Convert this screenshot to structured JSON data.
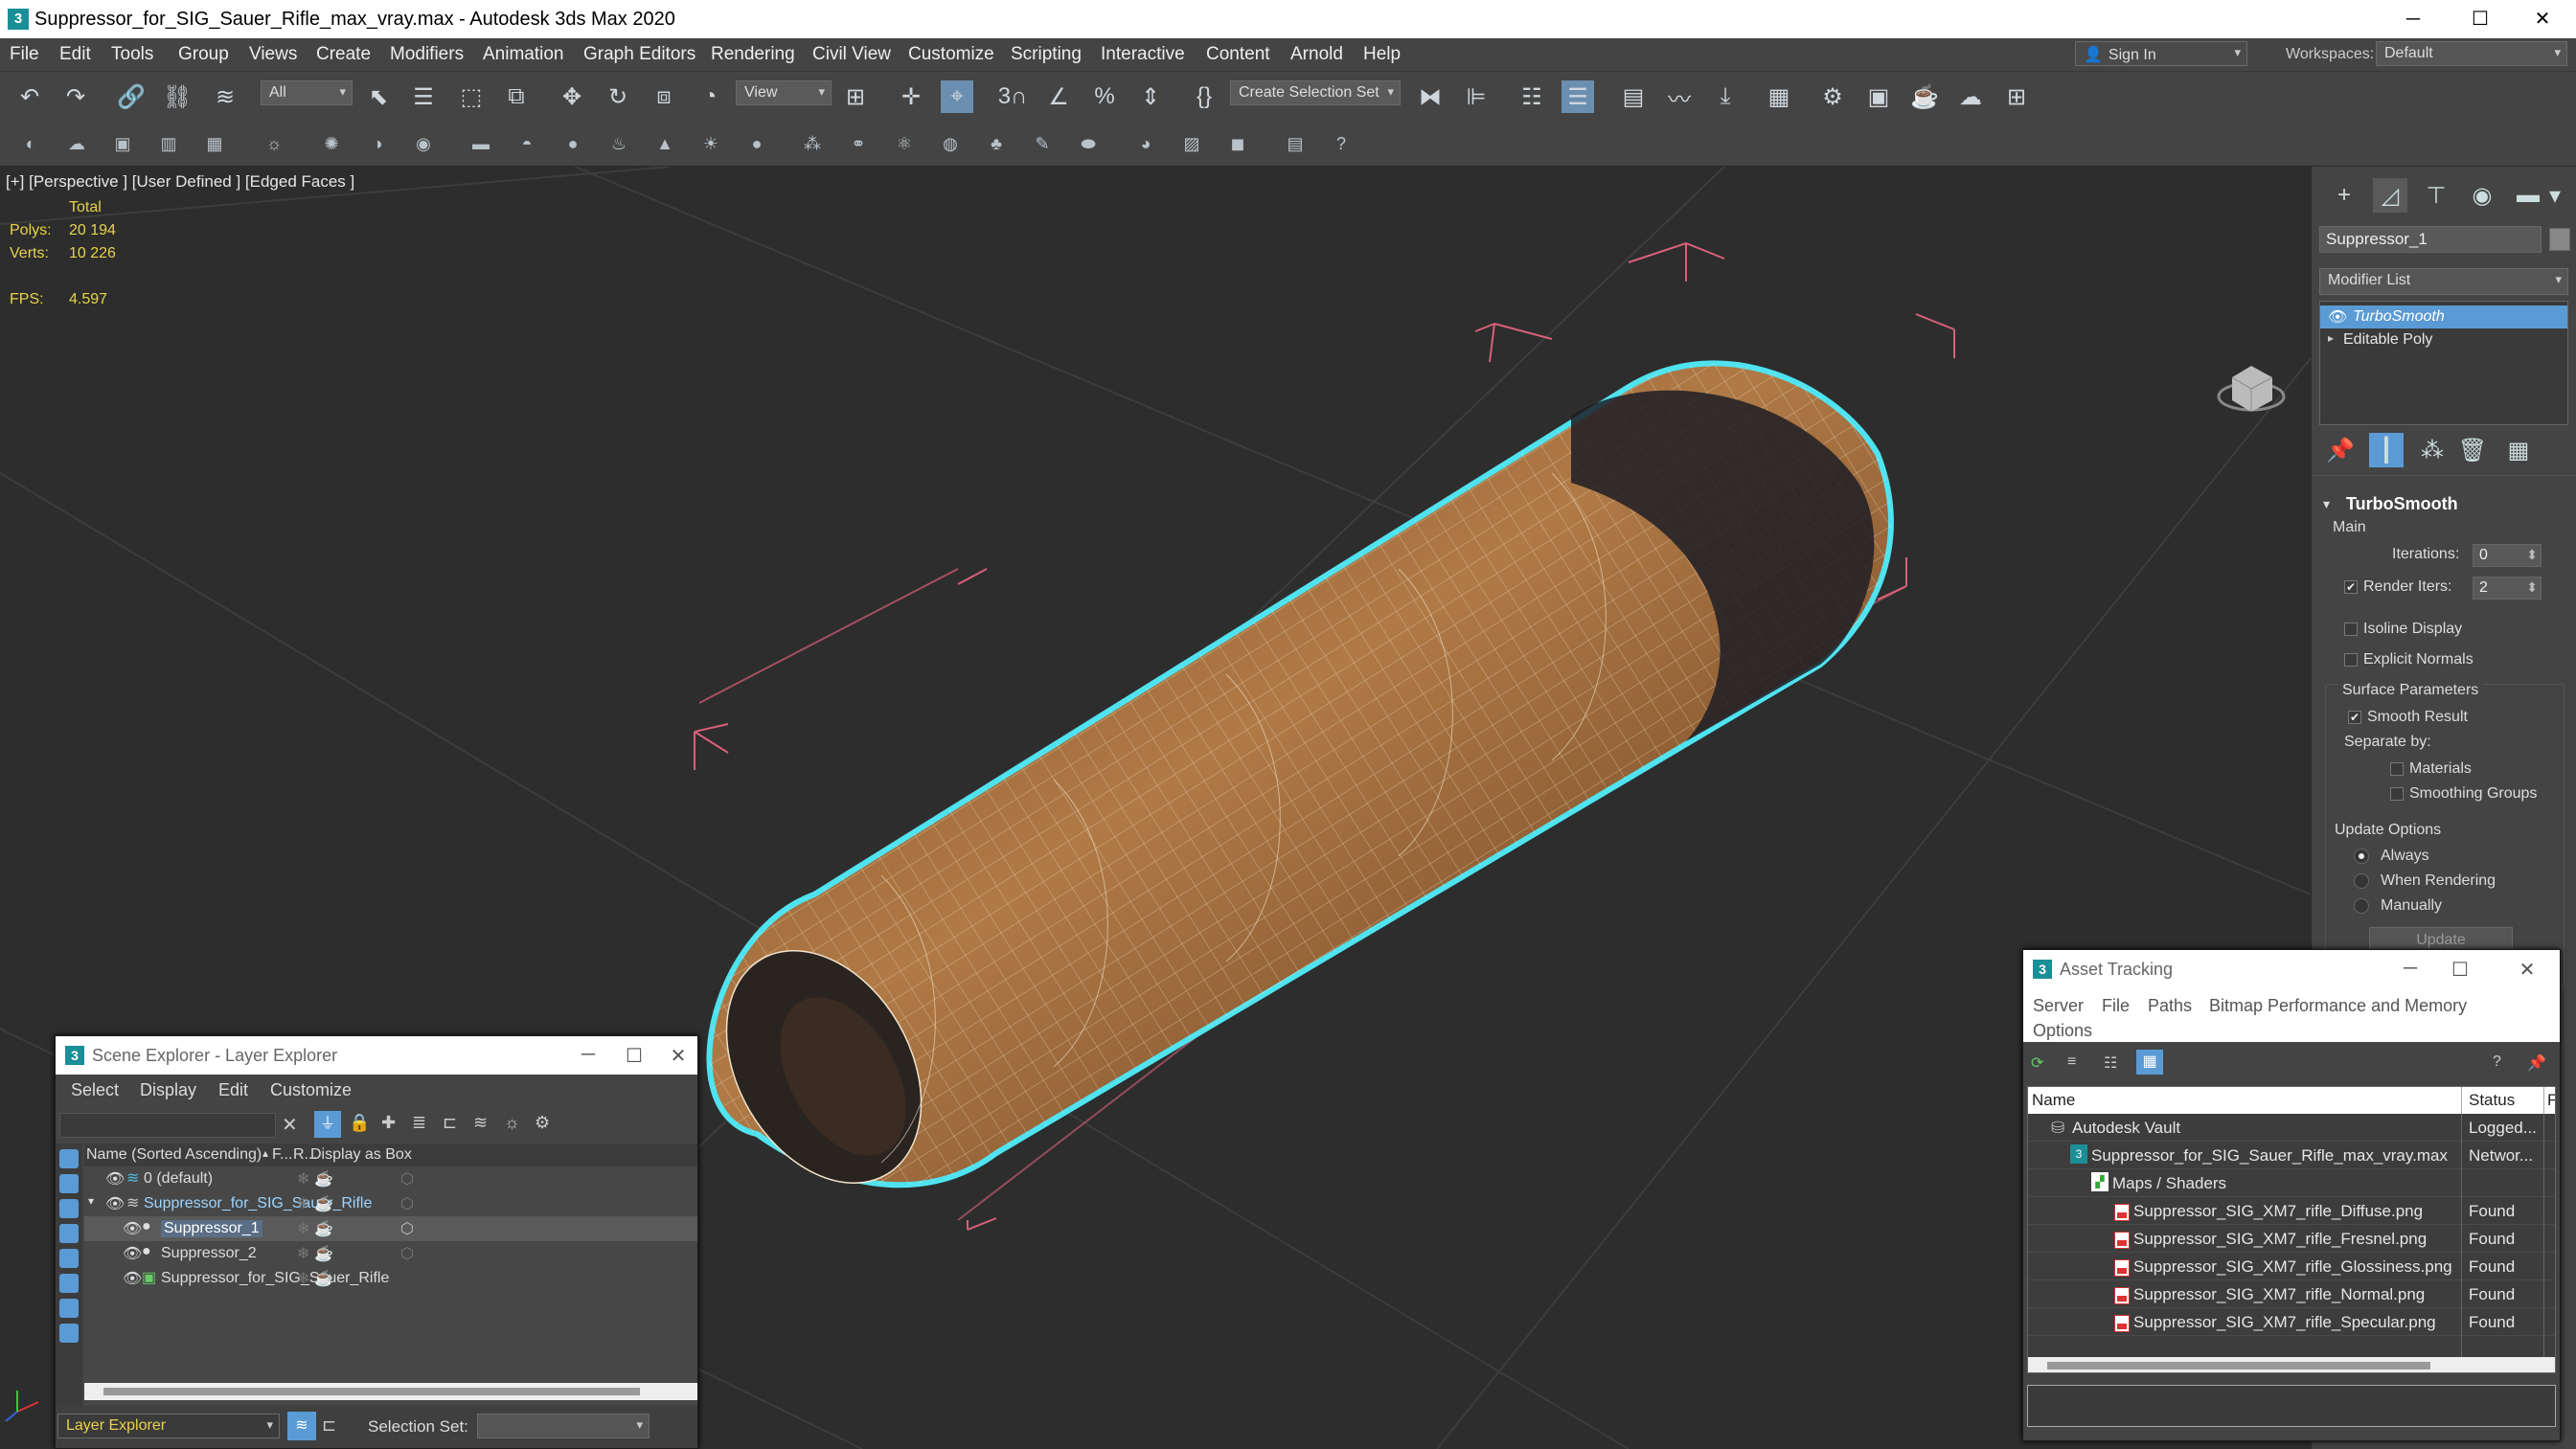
{
  "titlebar": {
    "title": "Suppressor_for_SIG_Sauer_Rifle_max_vray.max - Autodesk 3ds Max 2020",
    "app_icon": "3"
  },
  "menu": [
    "File",
    "Edit",
    "Tools",
    "Group",
    "Views",
    "Create",
    "Modifiers",
    "Animation",
    "Graph Editors",
    "Rendering",
    "Civil View",
    "Customize",
    "Scripting",
    "Interactive",
    "Content",
    "Arnold",
    "Help"
  ],
  "signin": {
    "label": "Sign In"
  },
  "workspaces": {
    "label": "Workspaces:",
    "value": "Default"
  },
  "toolbar": {
    "filter": "All",
    "view": "View",
    "selection_set": "Create Selection Set",
    "snap_label": "3"
  },
  "viewport": {
    "label": "[+] [Perspective ]  [User Defined ]  [Edged Faces ]",
    "stats": {
      "total_label": "Total",
      "polys_label": "Polys:",
      "polys": "20 194",
      "verts_label": "Verts:",
      "verts": "10 226",
      "fps_label": "FPS:",
      "fps": "4.597"
    }
  },
  "cmdpanel": {
    "object_name": "Suppressor_1",
    "modifier_list": "Modifier List",
    "stack": [
      "TurboSmooth",
      "Editable Poly"
    ],
    "rollout_title": "TurboSmooth",
    "main_label": "Main",
    "iterations_label": "Iterations:",
    "iterations": "0",
    "render_iters_label": "Render Iters:",
    "render_iters": "2",
    "isoline": "Isoline Display",
    "explicit": "Explicit Normals",
    "surface_params": "Surface Parameters",
    "smooth_result": "Smooth Result",
    "separate_by": "Separate by:",
    "materials": "Materials",
    "smoothing_groups": "Smoothing Groups",
    "update_options": "Update Options",
    "always": "Always",
    "when_rendering": "When Rendering",
    "manually": "Manually",
    "update_btn": "Update"
  },
  "scene_explorer": {
    "title": "Scene Explorer - Layer Explorer",
    "menu": [
      "Select",
      "Display",
      "Edit",
      "Customize"
    ],
    "columns": [
      "Name (Sorted Ascending)",
      "F...",
      "R...",
      "Display as Box"
    ],
    "rows": [
      "0 (default)",
      "Suppressor_for_SIG_Sauer_Rifle",
      "Suppressor_1",
      "Suppressor_2",
      "Suppressor_for_SIG_Sauer_Rifle"
    ],
    "footer_dropdown": "Layer Explorer",
    "selection_set_label": "Selection Set:"
  },
  "asset_tracking": {
    "title": "Asset Tracking",
    "menu": [
      "Server",
      "File",
      "Paths",
      "Bitmap Performance and Memory",
      "Options"
    ],
    "columns": [
      "Name",
      "Status",
      "F"
    ],
    "rows": [
      {
        "name": "Autodesk Vault",
        "status": "Logged..."
      },
      {
        "name": "Suppressor_for_SIG_Sauer_Rifle_max_vray.max",
        "status": "Networ..."
      },
      {
        "name": "Maps / Shaders",
        "status": ""
      },
      {
        "name": "Suppressor_SIG_XM7_rifle_Diffuse.png",
        "status": "Found"
      },
      {
        "name": "Suppressor_SIG_XM7_rifle_Fresnel.png",
        "status": "Found"
      },
      {
        "name": "Suppressor_SIG_XM7_rifle_Glossiness.png",
        "status": "Found"
      },
      {
        "name": "Suppressor_SIG_XM7_rifle_Normal.png",
        "status": "Found"
      },
      {
        "name": "Suppressor_SIG_XM7_rifle_Specular.png",
        "status": "Found"
      }
    ]
  },
  "colors": {
    "accent_blue": "#5b9bd5",
    "selection_cyan": "#4fe3f0",
    "stat_yellow": "#e8d34a",
    "bbox_pink": "#d8607a"
  }
}
